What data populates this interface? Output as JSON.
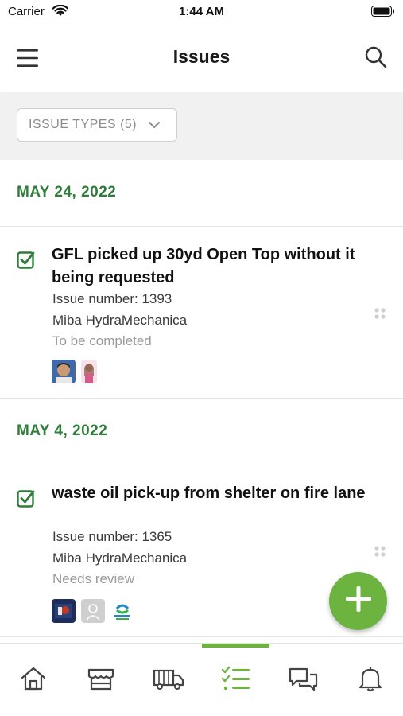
{
  "status_bar": {
    "carrier": "Carrier",
    "time": "1:44 AM"
  },
  "header": {
    "title": "Issues"
  },
  "filter": {
    "label": "ISSUE TYPES (5)"
  },
  "groups": [
    {
      "date": "MAY 24, 2022",
      "issue": {
        "title": "GFL picked up 30yd Open Top without it being requested",
        "number": "Issue number: 1393",
        "company": "Miba HydraMechanica",
        "status": "To be completed"
      }
    },
    {
      "date": "MAY 4, 2022",
      "issue": {
        "title": "waste oil pick-up from shelter on fire lane",
        "number": "Issue number: 1365",
        "company": "Miba HydraMechanica",
        "status": "Needs review"
      }
    }
  ],
  "bottom_nav": {
    "items": [
      "home-icon",
      "store-icon",
      "truck-icon",
      "checklist-icon",
      "chat-icon",
      "bell-icon"
    ],
    "active": "checklist-icon"
  },
  "colors": {
    "accent_green": "#6db33f",
    "date_green": "#2f7d3a"
  }
}
